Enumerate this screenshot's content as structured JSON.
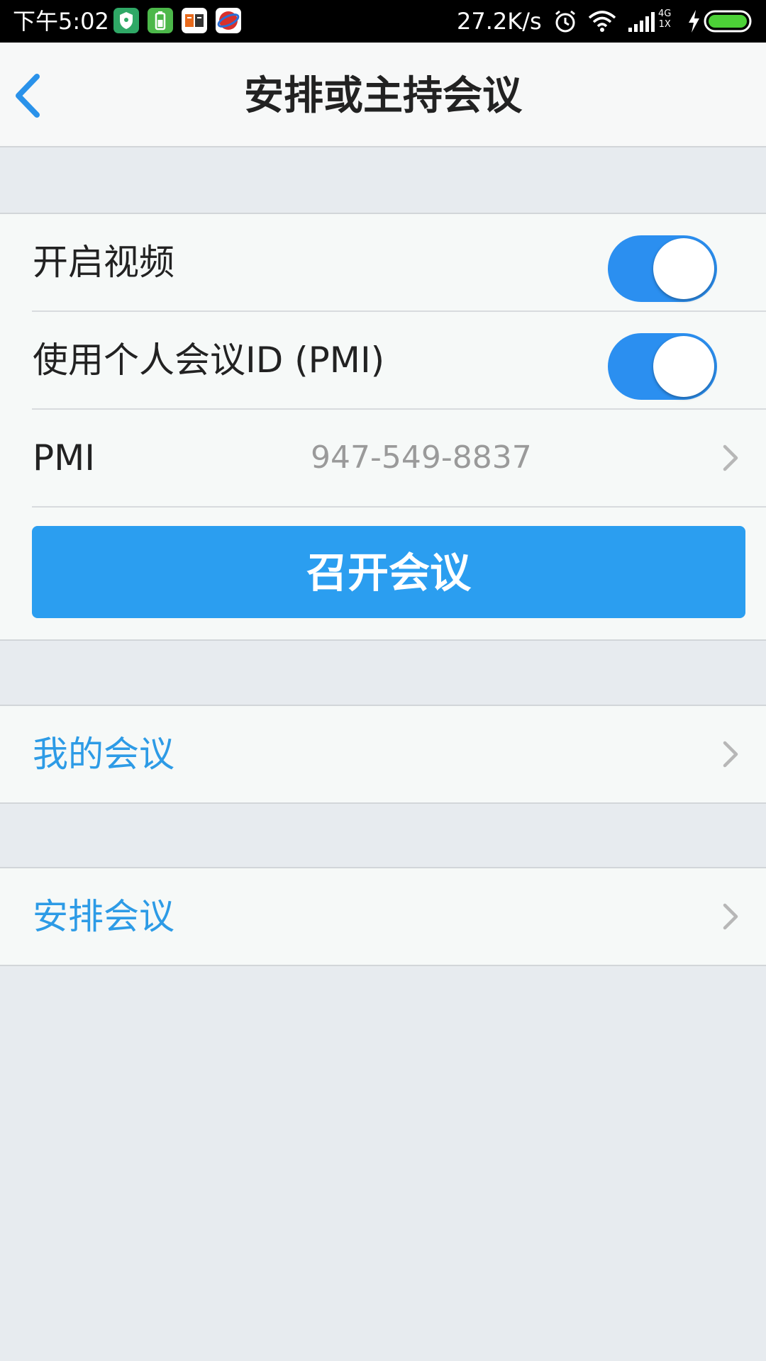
{
  "status_bar": {
    "time": "下午5:02",
    "network_speed": "27.2K/s",
    "network_type_top": "4G",
    "network_type_bottom": "1X",
    "app_icons": [
      "shield-app-icon",
      "battery-app-icon",
      "news-app-icon",
      "browser-app-icon"
    ],
    "icons": [
      "alarm-icon",
      "wifi-icon",
      "signal-icon",
      "charging-icon",
      "battery-icon"
    ]
  },
  "header": {
    "title": "安排或主持会议"
  },
  "settings": {
    "video_label": "开启视频",
    "video_enabled": true,
    "pmi_toggle_label": "使用个人会议ID (PMI)",
    "pmi_toggle_enabled": true,
    "pmi_label": "PMI",
    "pmi_value": "947-549-8837",
    "start_button_label": "召开会议"
  },
  "links": {
    "my_meetings": "我的会议",
    "schedule_meeting": "安排会议"
  },
  "colors": {
    "accent": "#2b9ef0",
    "toggle_on": "#2b8ff0",
    "link_text": "#2d9be6",
    "background": "#e7ebef"
  }
}
